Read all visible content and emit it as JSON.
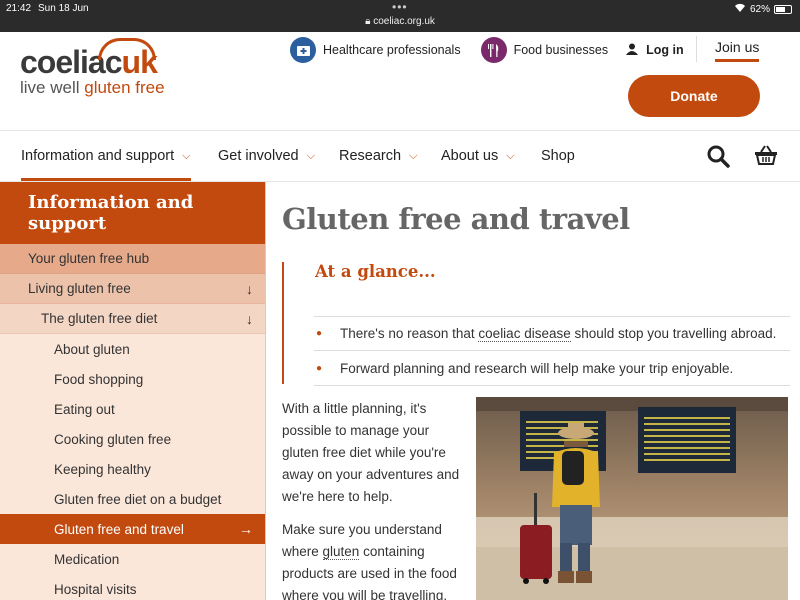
{
  "status": {
    "time": "21:42",
    "date": "Sun 18 Jun",
    "url": "coeliac.org.uk",
    "battery": "62%",
    "battery_level": 0.62
  },
  "logo": {
    "word1": "coeliac",
    "word2": "uk",
    "tag1": "live well ",
    "tag2": "gluten free"
  },
  "toplinks": {
    "healthcare": "Healthcare professionals",
    "food": "Food businesses",
    "login": "Log in",
    "join": "Join us",
    "donate": "Donate"
  },
  "nav": [
    "Information and support",
    "Get involved",
    "Research",
    "About us",
    "Shop"
  ],
  "sidebar": {
    "title": "Information and support",
    "items": [
      "Your gluten free hub",
      "Living gluten free",
      "The gluten free diet",
      "About gluten",
      "Food shopping",
      "Eating out",
      "Cooking gluten free",
      "Keeping healthy",
      "Gluten free diet on a budget",
      "Gluten free and travel",
      "Medication",
      "Hospital visits"
    ]
  },
  "main": {
    "title": "Gluten free and travel",
    "glance_title": "At a glance...",
    "bullet1_a": "There's no reason that ",
    "bullet1_link": "coeliac disease",
    "bullet1_b": " should stop you travelling abroad.",
    "bullet2": "Forward planning and research will help make your trip enjoyable.",
    "para1": "With a little planning, it's possible to manage your gluten free diet while you're away on your adventures and we're here to help.",
    "para2_a": "Make sure you understand where ",
    "para2_link": "gluten",
    "para2_b": " containing products are used in the food where you will be travelling."
  },
  "colors": {
    "brand": "#c24a0e",
    "healthcare": "#2b5f9e",
    "food": "#7a2a6b"
  }
}
